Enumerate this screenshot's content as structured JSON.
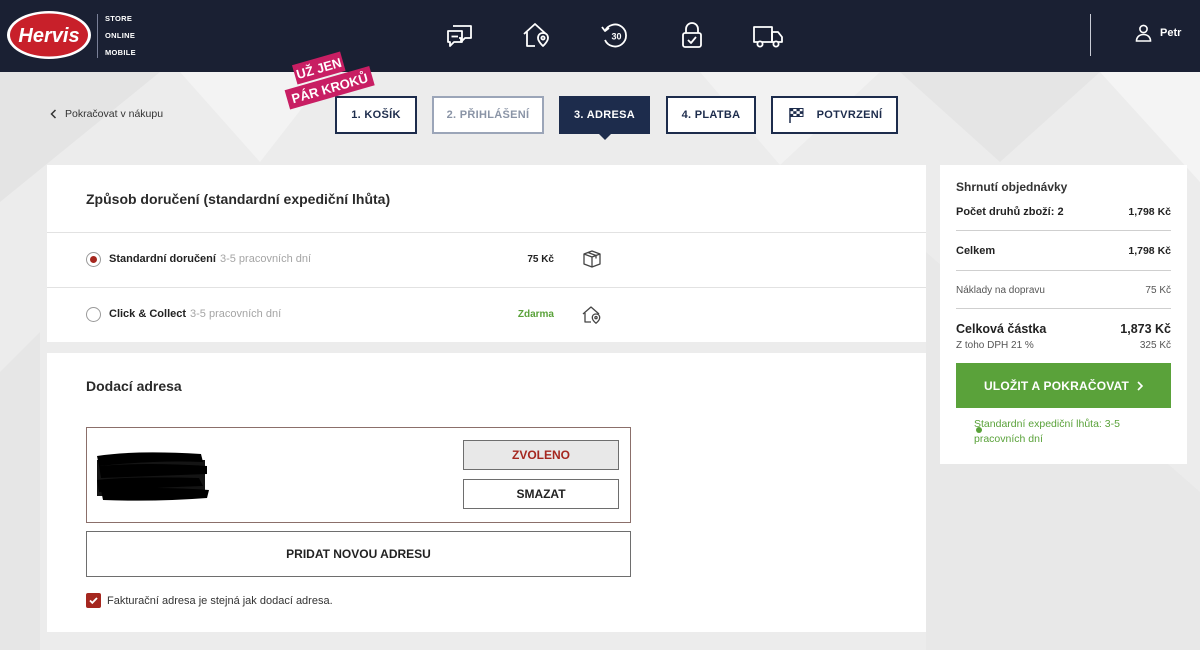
{
  "header": {
    "logo_text": "Hervis",
    "logo_sub": [
      "STORE",
      "ONLINE",
      "MOBILE"
    ],
    "icons": [
      "chat-icon",
      "home-location-icon",
      "return-30-icon",
      "lock-check-icon",
      "truck-icon"
    ],
    "return_days": "30",
    "user_name": "Petr"
  },
  "nav": {
    "back_label": "Pokračovat v nákupu",
    "promo_line1": "UŽ JEN",
    "promo_line2": "PÁR KROKŮ",
    "steps": [
      {
        "label": "1. KOŠÍK",
        "state": "done"
      },
      {
        "label": "2. PŘIHLÁŠENÍ",
        "state": "inactive"
      },
      {
        "label": "3. ADRESA",
        "state": "active"
      },
      {
        "label": "4. PLATBA",
        "state": "done"
      },
      {
        "label": "POTVRZENÍ",
        "state": "done"
      }
    ]
  },
  "delivery": {
    "title": "Způsob doručení (standardní expediční lhůta)",
    "options": [
      {
        "name": "Standardní doručení",
        "time": "3-5 pracovních dní",
        "price": "75 Kč",
        "selected": true,
        "icon": "package-icon"
      },
      {
        "name": "Click & Collect",
        "time": "3-5 pracovních dní",
        "price": "Zdarma",
        "selected": false,
        "icon": "store-pickup-icon"
      }
    ]
  },
  "address": {
    "title": "Dodací adresa",
    "selected_label": "ZVOLENO",
    "delete_label": "SMAZAT",
    "add_label": "PRIDAT NOVOU ADRESU",
    "billing_same": "Fakturační adresa je stejná jak dodací adresa.",
    "billing_checked": true
  },
  "summary": {
    "title": "Shrnutí objednávky",
    "items_label": "Počet druhů zboží: 2",
    "items_value": "1,798 Kč",
    "total_label": "Celkem",
    "total_value": "1,798 Kč",
    "shipping_label": "Náklady na dopravu",
    "shipping_value": "75 Kč",
    "grand_label": "Celková částka",
    "grand_value": "1,873 Kč",
    "vat_label": "Z toho DPH 21 %",
    "vat_value": "325 Kč",
    "save_label": "ULOŽIT A POKRAČOVAT",
    "note": "Standardní expediční lhůta: 3-5 pracovních dní"
  },
  "colors": {
    "header_bg": "#1a2033",
    "brand_red": "#a5271f",
    "navy": "#1d2c4c",
    "green": "#5aa23a"
  }
}
